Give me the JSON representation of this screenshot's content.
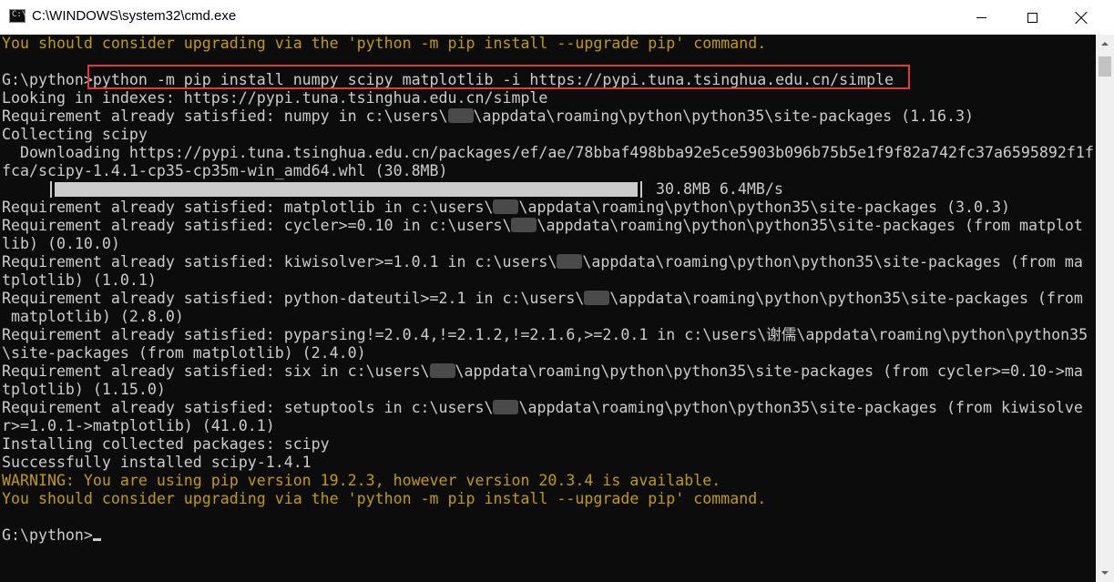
{
  "window": {
    "title": "C:\\WINDOWS\\system32\\cmd.exe",
    "icon": "cmd-icon",
    "icon_glyph": "C:\\"
  },
  "console": {
    "lines": [
      {
        "text": "You should consider upgrading via the 'python -m pip install --upgrade pip' command.",
        "color": "#c19c00"
      },
      {
        "text": "",
        "color": "#cccccc"
      },
      {
        "text": "G:\\python>python -m pip install numpy scipy matplotlib -i https://pypi.tuna.tsinghua.edu.cn/simple",
        "color": "#cccccc"
      },
      {
        "text": "Looking in indexes: https://pypi.tuna.tsinghua.edu.cn/simple",
        "color": "#cccccc"
      },
      {
        "pre": "Requirement already satisfied: numpy in c:\\users\\",
        "redacted": true,
        "post": "\\appdata\\roaming\\python\\python35\\site-packages (1.16.3)",
        "color": "#cccccc"
      },
      {
        "text": "Collecting scipy",
        "color": "#cccccc"
      },
      {
        "text": "  Downloading https://pypi.tuna.tsinghua.edu.cn/packages/ef/ae/78bbaf498bba92e5ce5903b096b75b5e1f9f82a742fc37a6595892f1f",
        "color": "#cccccc"
      },
      {
        "text": "fca/scipy-1.4.1-cp35-cp35m-win_amd64.whl (30.8MB)",
        "color": "#cccccc"
      },
      {
        "text": "",
        "color": "#cccccc"
      },
      {
        "pre": "Requirement already satisfied: matplotlib in c:\\users\\",
        "redacted": true,
        "post": "\\appdata\\roaming\\python\\python35\\site-packages (3.0.3)",
        "color": "#cccccc"
      },
      {
        "pre": "Requirement already satisfied: cycler>=0.10 in c:\\users\\",
        "redacted": true,
        "post": "\\appdata\\roaming\\python\\python35\\site-packages (from matplot",
        "color": "#cccccc"
      },
      {
        "text": "lib) (0.10.0)",
        "color": "#cccccc"
      },
      {
        "pre": "Requirement already satisfied: kiwisolver>=1.0.1 in c:\\users\\",
        "redacted": true,
        "post": "\\appdata\\roaming\\python\\python35\\site-packages (from ma",
        "color": "#cccccc"
      },
      {
        "text": "tplotlib) (1.0.1)",
        "color": "#cccccc"
      },
      {
        "pre": "Requirement already satisfied: python-dateutil>=2.1 in c:\\users\\",
        "redacted": true,
        "post": "\\appdata\\roaming\\python\\python35\\site-packages (from",
        "color": "#cccccc"
      },
      {
        "text": " matplotlib) (2.8.0)",
        "color": "#cccccc"
      },
      {
        "text": "Requirement already satisfied: pyparsing!=2.0.4,!=2.1.2,!=2.1.6,>=2.0.1 in c:\\users\\谢儒\\appdata\\roaming\\python\\python35",
        "color": "#cccccc"
      },
      {
        "text": "\\site-packages (from matplotlib) (2.4.0)",
        "color": "#cccccc"
      },
      {
        "pre": "Requirement already satisfied: six in c:\\users\\",
        "redacted": true,
        "post": "\\appdata\\roaming\\python\\python35\\site-packages (from cycler>=0.10->ma",
        "color": "#cccccc"
      },
      {
        "text": "tplotlib) (1.15.0)",
        "color": "#cccccc"
      },
      {
        "pre": "Requirement already satisfied: setuptools in c:\\users\\",
        "redacted": true,
        "post": "\\appdata\\roaming\\python\\python35\\site-packages (from kiwisolve",
        "color": "#cccccc"
      },
      {
        "text": "r>=1.0.1->matplotlib) (41.0.1)",
        "color": "#cccccc"
      },
      {
        "text": "Installing collected packages: scipy",
        "color": "#cccccc"
      },
      {
        "text": "Successfully installed scipy-1.4.1",
        "color": "#cccccc"
      },
      {
        "text": "WARNING: You are using pip version 19.2.3, however version 20.3.4 is available.",
        "color": "#c19c00"
      },
      {
        "text": "You should consider upgrading via the 'python -m pip install --upgrade pip' command.",
        "color": "#c19c00"
      },
      {
        "text": "",
        "color": "#cccccc"
      },
      {
        "text": "G:\\python>",
        "color": "#cccccc",
        "cursor": true
      }
    ],
    "progress": {
      "fraction": 1.0,
      "text": "30.8MB 6.4MB/s"
    },
    "background": "#0c0c0c",
    "foreground": "#cccccc",
    "warning_color": "#c19c00",
    "highlight_color": "#e53935"
  }
}
